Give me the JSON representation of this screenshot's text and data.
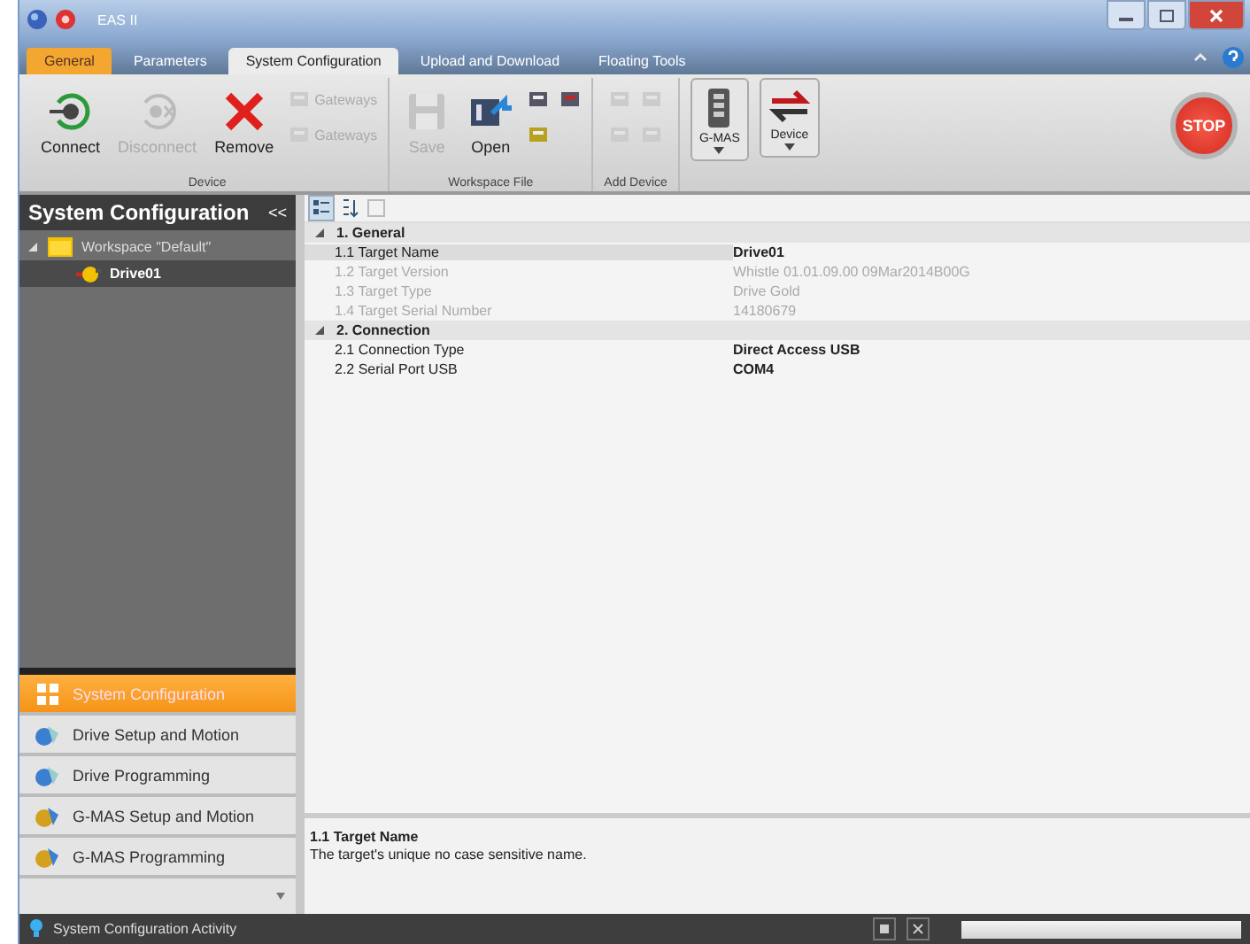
{
  "window": {
    "title": "EAS II"
  },
  "tabs": [
    {
      "label": "General",
      "kind": "app",
      "selected": false
    },
    {
      "label": "Parameters",
      "kind": "tab",
      "selected": false
    },
    {
      "label": "System Configuration",
      "kind": "tab",
      "selected": true
    },
    {
      "label": "Upload and Download",
      "kind": "tab",
      "selected": false
    },
    {
      "label": "Floating Tools",
      "kind": "tab",
      "selected": false
    }
  ],
  "ribbon": [
    {
      "label": "Device",
      "buttons": [
        {
          "kind": "large",
          "label": "Connect",
          "disabled": false
        },
        {
          "kind": "large",
          "label": "Disconnect",
          "disabled": true
        },
        {
          "kind": "large",
          "label": "Remove",
          "disabled": false
        },
        {
          "kind": "stack",
          "items": [
            {
              "label": "Gateways",
              "disabled": true
            },
            {
              "label": "Gateways",
              "disabled": true
            }
          ]
        }
      ]
    },
    {
      "label": "Workspace File",
      "buttons": [
        {
          "kind": "large",
          "label": "Save",
          "disabled": true
        },
        {
          "kind": "large",
          "label": "Open",
          "disabled": false
        },
        {
          "kind": "stack",
          "items": [
            {
              "disabled": false
            },
            {
              "disabled": false
            }
          ]
        },
        {
          "kind": "stack",
          "items": [
            {
              "disabled": false
            }
          ]
        }
      ]
    },
    {
      "label": "Add Device",
      "buttons": [
        {
          "kind": "stack",
          "items": [
            {
              "disabled": true
            },
            {
              "disabled": true
            }
          ]
        },
        {
          "kind": "stack",
          "items": [
            {
              "disabled": true
            },
            {
              "disabled": true
            }
          ]
        }
      ]
    },
    {
      "buttons": [
        {
          "kind": "big",
          "label": "G-MAS",
          "disabled": false
        },
        {
          "kind": "big",
          "label": "Device",
          "disabled": false
        }
      ]
    }
  ],
  "stop_button": "STOP",
  "panel": {
    "title": "System Configuration",
    "collapse": "<<",
    "tree": [
      {
        "label": "Workspace \"Default\"",
        "expanded": true,
        "selected": false,
        "children": [
          {
            "label": "Drive01",
            "selected": true
          }
        ]
      }
    ]
  },
  "nav": [
    {
      "label": "System Configuration",
      "selected": true
    },
    {
      "label": "Drive Setup and Motion",
      "selected": false
    },
    {
      "label": "Drive Programming",
      "selected": false
    },
    {
      "label": "G-MAS Setup and Motion",
      "selected": false
    },
    {
      "label": "G-MAS Programming",
      "selected": false
    }
  ],
  "grid": [
    {
      "label": "1. General",
      "expanded": true,
      "properties": [
        {
          "name": "1.1 Target Name",
          "value": "Drive01",
          "readonly": false,
          "selected": true
        },
        {
          "name": "1.2 Target Version",
          "value": "Whistle 01.01.09.00 09Mar2014B00G",
          "readonly": true,
          "selected": false
        },
        {
          "name": "1.3 Target Type",
          "value": "Drive Gold",
          "readonly": true,
          "selected": false
        },
        {
          "name": "1.4 Target Serial Number",
          "value": "14180679",
          "readonly": true,
          "selected": false
        }
      ]
    },
    {
      "label": "2. Connection",
      "expanded": true,
      "properties": [
        {
          "name": "2.1 Connection Type",
          "value": "Direct Access USB",
          "readonly": false,
          "selected": false
        },
        {
          "name": "2.2 Serial Port USB",
          "value": "COM4",
          "readonly": false,
          "selected": false
        }
      ]
    }
  ],
  "description": {
    "title": "1.1 Target Name",
    "text": "The target's unique no case sensitive name."
  },
  "status_bar": {
    "text": "System Configuration Activity",
    "progress": {
      "level": 0
    }
  }
}
